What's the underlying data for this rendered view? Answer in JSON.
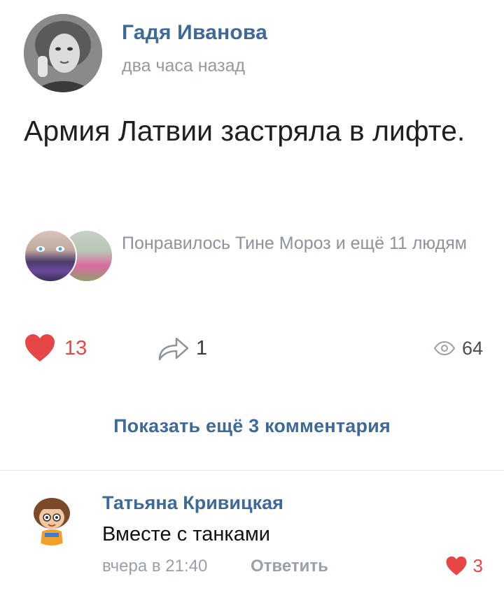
{
  "post": {
    "author": "Гадя Иванова",
    "time": "два часа назад",
    "text": "Армия Латвии застряла в лифте.",
    "likes_text": "Понравилось Тине Мороз и ещё 11 людям",
    "actions": {
      "like_count": "13",
      "share_count": "1",
      "views_count": "64"
    },
    "show_more": "Показать ещё 3 комментария"
  },
  "comment": {
    "author": "Татьяна Кривицкая",
    "text": "Вместе с танками",
    "time": "вчера в 21:40",
    "reply_label": "Ответить",
    "like_count": "3"
  },
  "colors": {
    "link_blue": "#3f6a98",
    "like_red": "#e64646",
    "muted_gray": "#939aa3",
    "text_dark": "#1f1f1f"
  },
  "icons": {
    "like": "heart-icon",
    "share": "share-icon",
    "views": "eye-icon"
  }
}
